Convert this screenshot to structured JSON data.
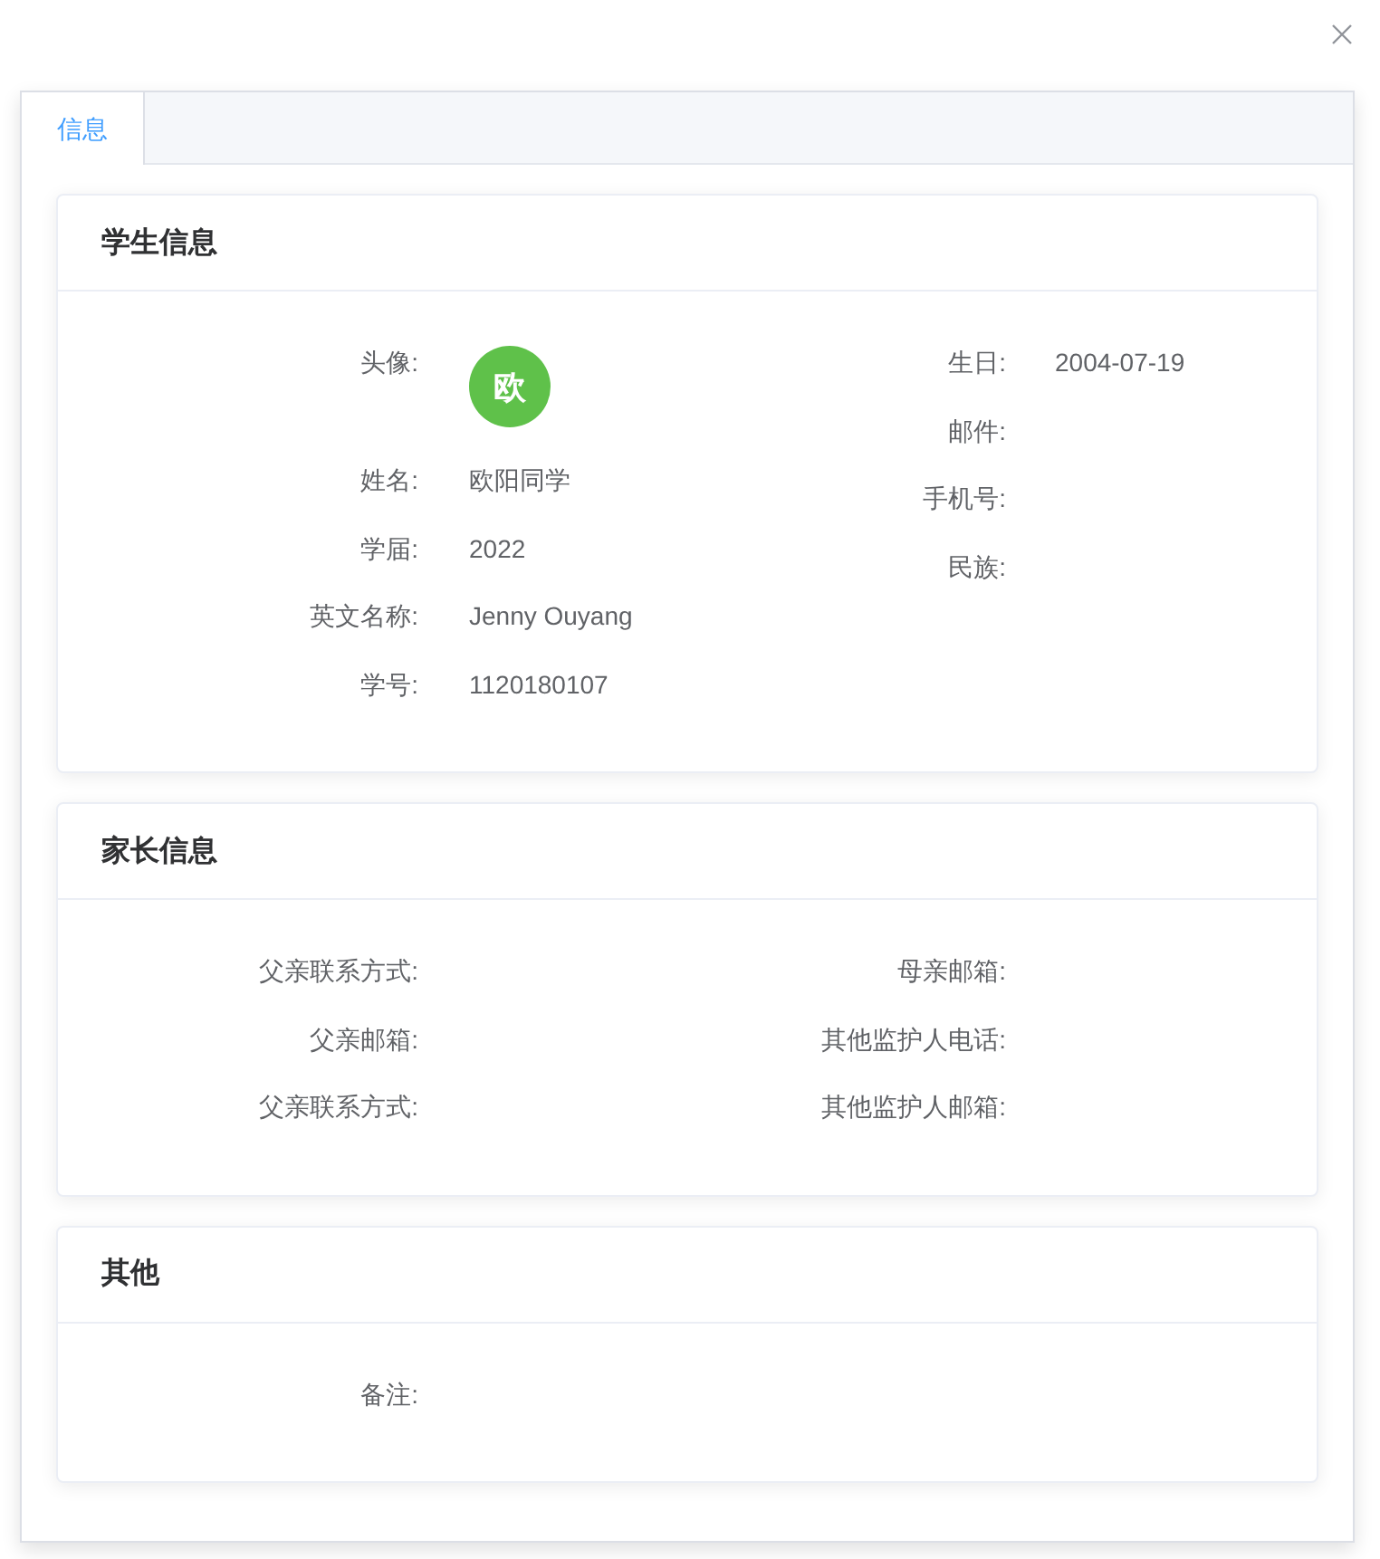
{
  "tabs": [
    {
      "label": "信息",
      "selected": true
    }
  ],
  "sections": [
    {
      "title": "学生信息",
      "columns": [
        [
          {
            "kind": "avatar",
            "label": "头像:",
            "value": "欧"
          },
          {
            "kind": "text",
            "label": "姓名:",
            "value": "欧阳同学"
          },
          {
            "kind": "text",
            "label": "学届:",
            "value": "2022"
          },
          {
            "kind": "text",
            "label": "英文名称:",
            "value": "Jenny Ouyang"
          },
          {
            "kind": "text",
            "label": "学号:",
            "value": "1120180107"
          }
        ],
        [
          {
            "kind": "text",
            "label": "生日:",
            "value": "2004-07-19"
          },
          {
            "kind": "text",
            "label": "邮件:"
          },
          {
            "kind": "text",
            "label": "手机号:"
          },
          {
            "kind": "text",
            "label": "民族:"
          }
        ]
      ]
    },
    {
      "title": "家长信息",
      "columns": [
        [
          {
            "kind": "text",
            "label": "父亲联系方式:"
          },
          {
            "kind": "text",
            "label": "父亲邮箱:"
          },
          {
            "kind": "text",
            "label": "父亲联系方式:"
          }
        ],
        [
          {
            "kind": "text",
            "label": "母亲邮箱:"
          },
          {
            "kind": "text",
            "label": "其他监护人电话:"
          },
          {
            "kind": "text",
            "label": "其他监护人邮箱:"
          }
        ]
      ]
    },
    {
      "title": "其他",
      "columns": [
        [
          {
            "kind": "text",
            "label": "备注:"
          }
        ]
      ]
    }
  ]
}
